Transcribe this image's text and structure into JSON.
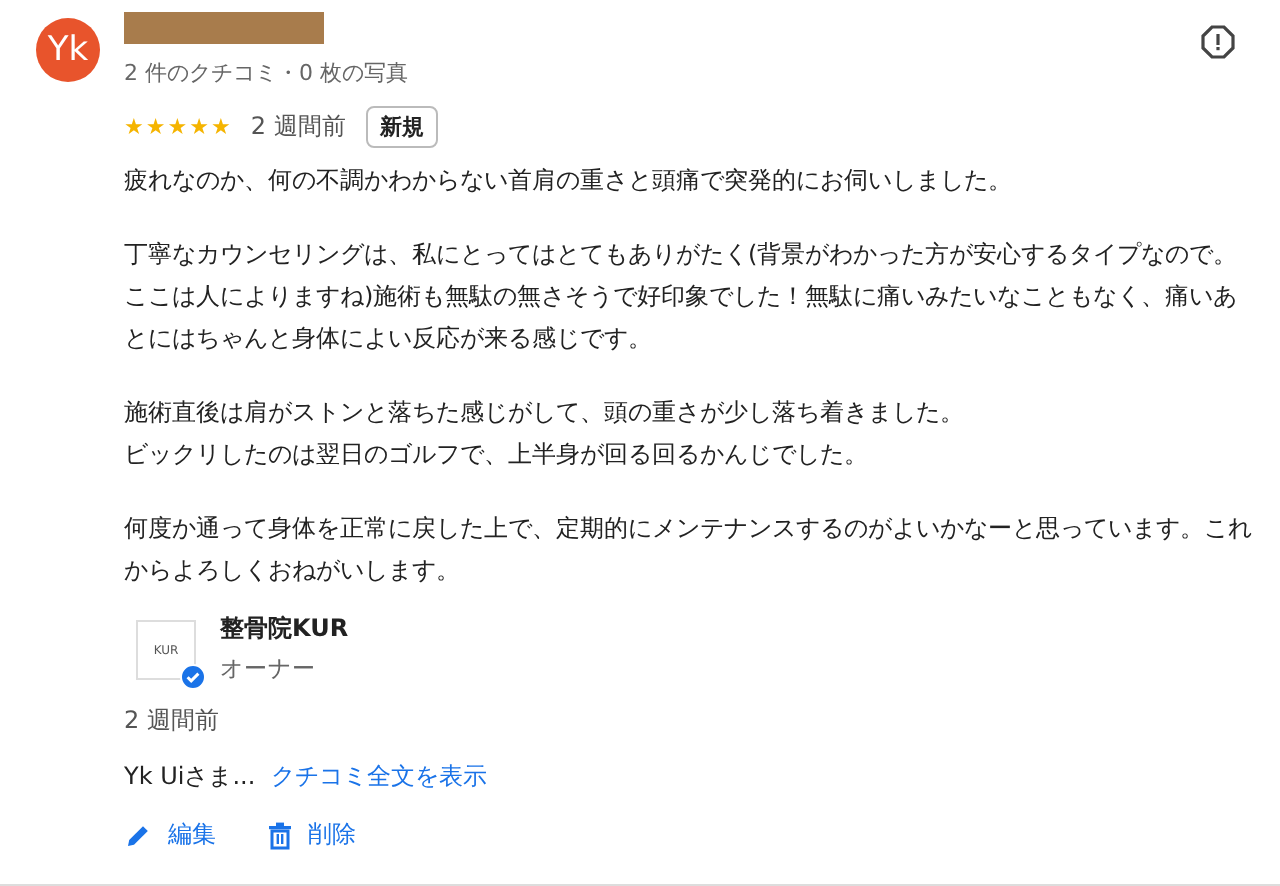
{
  "review": {
    "avatar_initials": "Yk",
    "author_redacted": true,
    "author_stats": "2 件のクチコミ・0 枚の写真",
    "stars": 5,
    "time": "2 週間前",
    "badge": "新規",
    "paragraphs": [
      [
        "疲れなのか、何の不調かわからない首肩の重さと頭痛で突発的にお伺いしました。"
      ],
      [
        "丁寧なカウンセリングは、私にとってはとてもありがたく(背景がわかった方が安心するタイプなので。ここは人によりますね)施術も無駄の無さそうで好印象でした！無駄に痛いみたいなこともなく、痛いあとにはちゃんと身体によい反応が来る感じです。"
      ],
      [
        "施術直後は肩がストンと落ちた感じがして、頭の重さが少し落ち着きました。",
        "ビックリしたのは翌日のゴルフで、上半身が回る回るかんじでした。"
      ],
      [
        "何度か通って身体を正常に戻した上で、定期的にメンテナンスするのがよいかなーと思っています。これからよろしくおねがいします。"
      ]
    ]
  },
  "owner_reply": {
    "logo_text": "KUR",
    "verified": true,
    "name": "整骨院KUR",
    "role": "オーナー",
    "time": "2 週間前",
    "excerpt": "Yk Uiさま...",
    "link": "クチコミ全文を表示"
  },
  "actions": [
    {
      "kind": "edit",
      "label": "編集"
    },
    {
      "kind": "delete",
      "label": "削除"
    }
  ]
}
